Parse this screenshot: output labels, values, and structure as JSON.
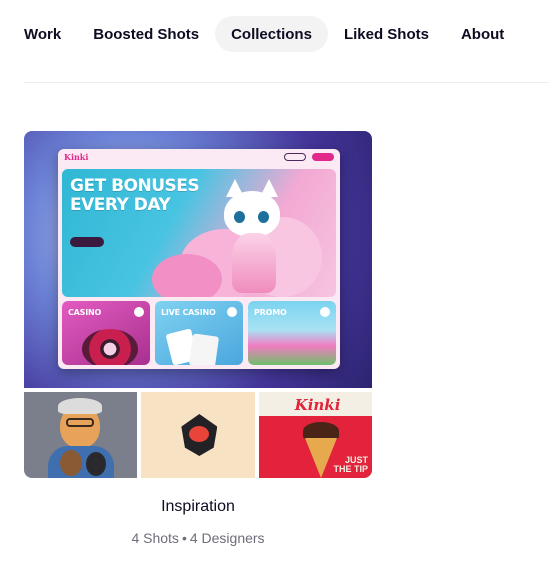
{
  "tabs": [
    {
      "label": "Work",
      "active": false
    },
    {
      "label": "Boosted Shots",
      "active": false
    },
    {
      "label": "Collections",
      "active": true
    },
    {
      "label": "Liked Shots",
      "active": false
    },
    {
      "label": "About",
      "active": false
    }
  ],
  "collection": {
    "title": "Inspiration",
    "shots": "4 Shots",
    "separator": "•",
    "designers": "4 Designers"
  },
  "thumbnail": {
    "logo": "Kinki",
    "hero_line1": "GET BONUSES",
    "hero_line2": "EVERY DAY",
    "tiles": [
      "CASINO",
      "LIVE CASINO",
      "PROMO"
    ],
    "poster_brand": "Kinki",
    "poster_caption_line1": "JUST",
    "poster_caption_line2": "THE TIP"
  },
  "colors": {
    "accent": "#e0298a",
    "active_tab_bg": "#f3f3f4",
    "meta_text": "#6e6d7a"
  }
}
